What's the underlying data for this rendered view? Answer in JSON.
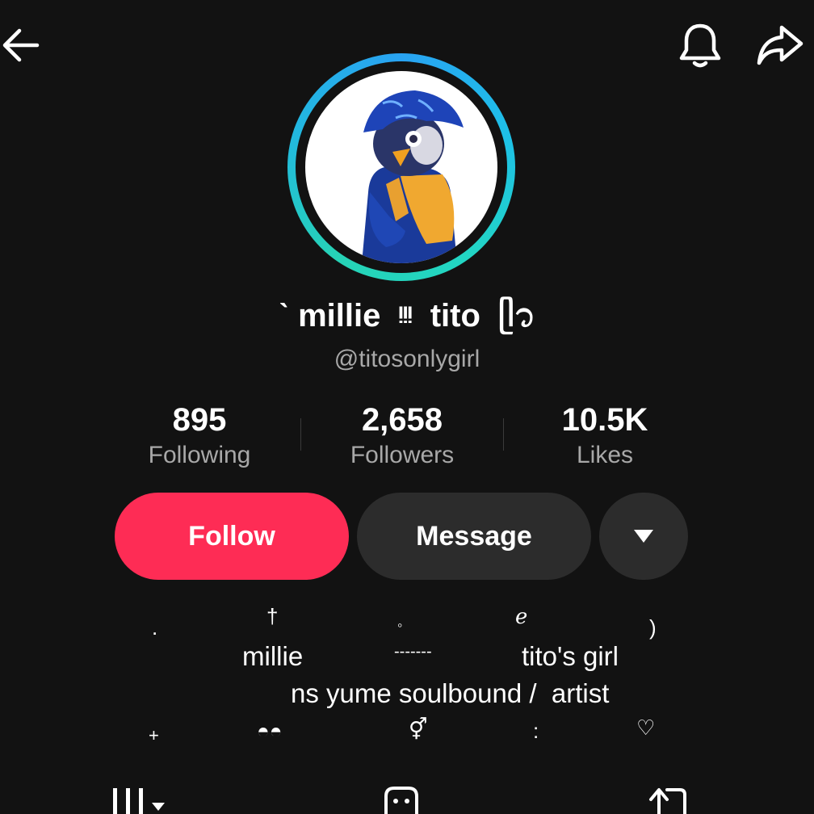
{
  "header": {
    "back_icon": "arrow-left-icon",
    "bell_icon": "bell-icon",
    "share_icon": "share-arrow-icon"
  },
  "profile": {
    "display_name": "ˋ millie  ᵎᵎᵎ  tito  ᥫ᭡",
    "username": "@titosonlygirl",
    "ring_colors": [
      "#29a3f2",
      "#22d6c4"
    ]
  },
  "stats": {
    "following": {
      "value": "895",
      "label": "Following"
    },
    "followers": {
      "value": "2,658",
      "label": "Followers"
    },
    "likes": {
      "value": "10.5K",
      "label": "Likes"
    }
  },
  "actions": {
    "follow_label": "Follow",
    "message_label": "Message",
    "more_icon": "triangle-down-icon",
    "follow_color": "#fe2c55"
  },
  "bio": {
    "row1": {
      "g1": ".",
      "g2": "†",
      "g3": "◦",
      "g4": "ℯ",
      "g5": ")"
    },
    "line2_left": "millie",
    "line2_mid": "-------",
    "line2_right": "tito's girl",
    "line3": "ns yume soulbound /  artist",
    "row4": {
      "g1": "+",
      "g2": "◓◓",
      "g3": "⚥",
      "g4": ":",
      "g5": "♡"
    }
  },
  "tabs": {
    "videos_icon": "grid-icon",
    "private_icon": "lock-face-icon",
    "reposts_icon": "repost-icon"
  }
}
